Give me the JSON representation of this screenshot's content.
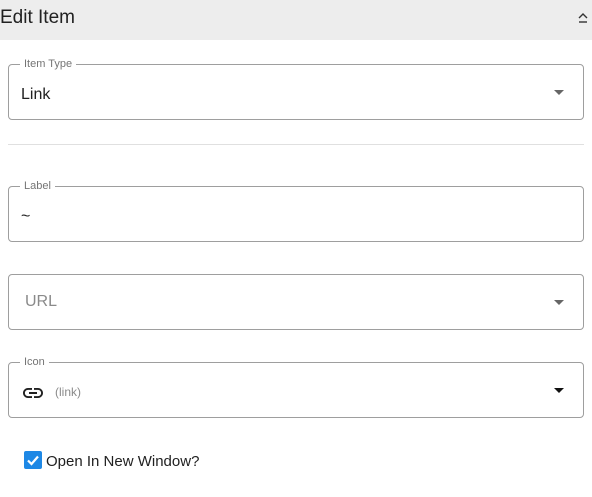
{
  "panel": {
    "title": "Edit Item"
  },
  "item_type": {
    "label": "Item Type",
    "value": "Link"
  },
  "label_field": {
    "label": "Label",
    "value": "~"
  },
  "url_field": {
    "placeholder": "URL"
  },
  "icon_field": {
    "label": "Icon",
    "icon": "link-icon",
    "value": "(link)"
  },
  "open_new_window": {
    "label": "Open In New Window?",
    "checked": true
  },
  "colors": {
    "header_bg": "#ededed",
    "checkbox_accent": "#1e88e5",
    "border": "#9e9e9e"
  }
}
